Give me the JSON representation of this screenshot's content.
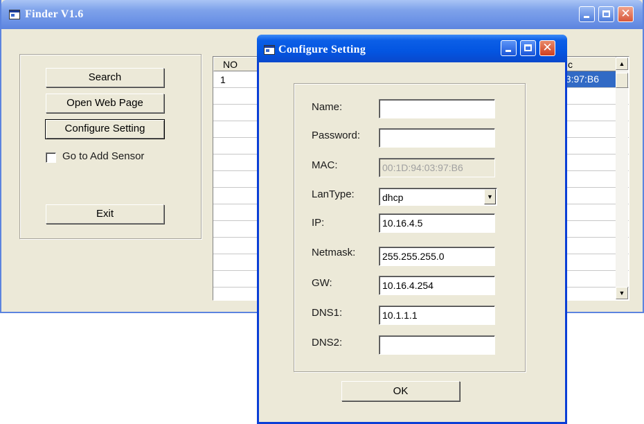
{
  "finder": {
    "title": "Finder V1.6",
    "buttons": {
      "search": "Search",
      "open_web_page": "Open Web Page",
      "configure_setting": "Configure Setting",
      "exit": "Exit"
    },
    "checkbox": {
      "label": "Go to Add Sensor",
      "checked": false
    },
    "list": {
      "columns": [
        "NO",
        "c"
      ],
      "rows": [
        {
          "no": "1",
          "mac_fragment": "03:97:B6"
        }
      ]
    }
  },
  "dialog": {
    "title": "Configure Setting",
    "fields": {
      "name": {
        "label": "Name:",
        "value": ""
      },
      "password": {
        "label": "Password:",
        "value": ""
      },
      "mac": {
        "label": "MAC:",
        "value": "00:1D:94:03:97:B6"
      },
      "lantype": {
        "label": "LanType:",
        "value": "dhcp"
      },
      "ip": {
        "label": "IP:",
        "value": "10.16.4.5"
      },
      "netmask": {
        "label": "Netmask:",
        "value": "255.255.255.0"
      },
      "gw": {
        "label": "GW:",
        "value": "10.16.4.254"
      },
      "dns1": {
        "label": "DNS1:",
        "value": "10.1.1.1"
      },
      "dns2": {
        "label": "DNS2:",
        "value": ""
      }
    },
    "ok_label": "OK"
  },
  "colors": {
    "window_face": "#ece9d8",
    "selection": "#316ac5",
    "active_titlebar": "#0355e1",
    "inactive_titlebar": "#7ea2ea"
  },
  "icons": {
    "title_icon": "app-window-icon",
    "minimize": "minimize-icon",
    "maximize": "maximize-icon",
    "close": "close-icon",
    "dropdown": "chevron-down-icon",
    "scroll_up": "scroll-up-icon",
    "scroll_down": "scroll-down-icon"
  }
}
